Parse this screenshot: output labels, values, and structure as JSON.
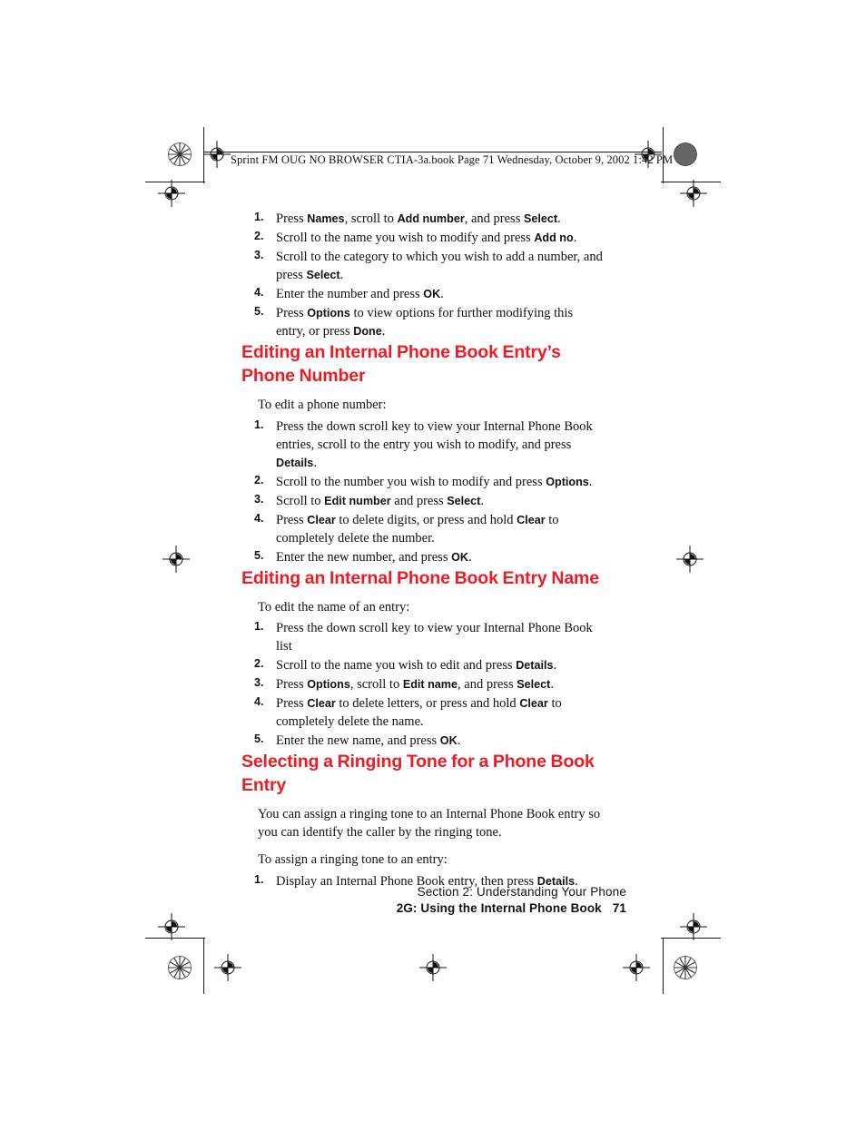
{
  "header": {
    "filename_line": "Sprint FM OUG NO BROWSER CTIA-3a.book  Page 71  Wednesday, October 9, 2002  1:42 PM"
  },
  "colors": {
    "heading_red": "#ED1C24",
    "body_text": "#111111"
  },
  "content": {
    "top_list": [
      {
        "num": "1.",
        "parts": [
          {
            "t": "Press ",
            "b": false
          },
          {
            "t": "Names",
            "b": true
          },
          {
            "t": ", scroll to ",
            "b": false
          },
          {
            "t": "Add number",
            "b": true
          },
          {
            "t": ", and press ",
            "b": false
          },
          {
            "t": "Select",
            "b": true
          },
          {
            "t": ".",
            "b": false
          }
        ]
      },
      {
        "num": "2.",
        "parts": [
          {
            "t": "Scroll to the name you wish to modify and press ",
            "b": false
          },
          {
            "t": "Add no",
            "b": true
          },
          {
            "t": ".",
            "b": false
          }
        ]
      },
      {
        "num": "3.",
        "parts": [
          {
            "t": "Scroll to the category to which you wish to add a number, and press ",
            "b": false
          },
          {
            "t": "Select",
            "b": true
          },
          {
            "t": ".",
            "b": false
          }
        ]
      },
      {
        "num": "4.",
        "parts": [
          {
            "t": "Enter the number and press ",
            "b": false
          },
          {
            "t": "OK",
            "b": true
          },
          {
            "t": ".",
            "b": false
          }
        ]
      },
      {
        "num": "5.",
        "parts": [
          {
            "t": "Press ",
            "b": false
          },
          {
            "t": "Options",
            "b": true
          },
          {
            "t": " to view options for further modifying this entry, or press ",
            "b": false
          },
          {
            "t": "Done",
            "b": true
          },
          {
            "t": ".",
            "b": false
          }
        ]
      }
    ],
    "sections": [
      {
        "heading": "Editing an Internal Phone Book Entry’s Phone Number",
        "paragraphs": [],
        "intro": "To edit a phone number:",
        "list": [
          {
            "num": "1.",
            "parts": [
              {
                "t": "Press the down scroll key to view your Internal Phone Book entries, scroll to the entry you wish to modify, and press ",
                "b": false
              },
              {
                "t": "Details",
                "b": true
              },
              {
                "t": ".",
                "b": false
              }
            ]
          },
          {
            "num": "2.",
            "parts": [
              {
                "t": "Scroll to the number you wish to modify and press ",
                "b": false
              },
              {
                "t": "Options",
                "b": true
              },
              {
                "t": ".",
                "b": false
              }
            ]
          },
          {
            "num": "3.",
            "parts": [
              {
                "t": "Scroll to ",
                "b": false
              },
              {
                "t": "Edit number",
                "b": true
              },
              {
                "t": " and press ",
                "b": false
              },
              {
                "t": "Select",
                "b": true
              },
              {
                "t": ".",
                "b": false
              }
            ]
          },
          {
            "num": "4.",
            "parts": [
              {
                "t": "Press ",
                "b": false
              },
              {
                "t": "Clear",
                "b": true
              },
              {
                "t": " to delete digits, or press and hold ",
                "b": false
              },
              {
                "t": "Clear",
                "b": true
              },
              {
                "t": " to completely delete the number.",
                "b": false
              }
            ]
          },
          {
            "num": "5.",
            "parts": [
              {
                "t": "Enter the new number, and press ",
                "b": false
              },
              {
                "t": "OK",
                "b": true
              },
              {
                "t": ".",
                "b": false
              }
            ]
          }
        ]
      },
      {
        "heading": "Editing an Internal Phone Book Entry Name",
        "paragraphs": [],
        "intro": "To edit the name of an entry:",
        "list": [
          {
            "num": "1.",
            "parts": [
              {
                "t": "Press the down scroll key to view your Internal Phone Book list",
                "b": false
              }
            ]
          },
          {
            "num": "2.",
            "parts": [
              {
                "t": "Scroll to the name you wish to edit and press ",
                "b": false
              },
              {
                "t": "Details",
                "b": true
              },
              {
                "t": ".",
                "b": false
              }
            ]
          },
          {
            "num": "3.",
            "parts": [
              {
                "t": "Press ",
                "b": false
              },
              {
                "t": "Options",
                "b": true
              },
              {
                "t": ", scroll to ",
                "b": false
              },
              {
                "t": "Edit name",
                "b": true
              },
              {
                "t": ", and press ",
                "b": false
              },
              {
                "t": "Select",
                "b": true
              },
              {
                "t": ".",
                "b": false
              }
            ]
          },
          {
            "num": "4.",
            "parts": [
              {
                "t": "Press ",
                "b": false
              },
              {
                "t": "Clear",
                "b": true
              },
              {
                "t": " to delete letters, or press and hold ",
                "b": false
              },
              {
                "t": "Clear",
                "b": true
              },
              {
                "t": " to completely delete the name.",
                "b": false
              }
            ]
          },
          {
            "num": "5.",
            "parts": [
              {
                "t": "Enter the new name, and press ",
                "b": false
              },
              {
                "t": "OK",
                "b": true
              },
              {
                "t": ".",
                "b": false
              }
            ]
          }
        ]
      },
      {
        "heading": "Selecting a Ringing Tone for a Phone Book Entry",
        "paragraphs": [
          "You can assign a ringing tone to an Internal Phone Book entry so you can identify the caller by the ringing tone."
        ],
        "intro": "To assign a ringing tone to an entry:",
        "list": [
          {
            "num": "1.",
            "parts": [
              {
                "t": "Display an Internal Phone Book entry, then press ",
                "b": false
              },
              {
                "t": "Details",
                "b": true
              },
              {
                "t": ".",
                "b": false
              }
            ]
          }
        ]
      }
    ]
  },
  "footer": {
    "section_line": "Section 2: Understanding Your Phone",
    "chapter_line": "2G: Using the Internal Phone Book",
    "page_number": "71"
  }
}
